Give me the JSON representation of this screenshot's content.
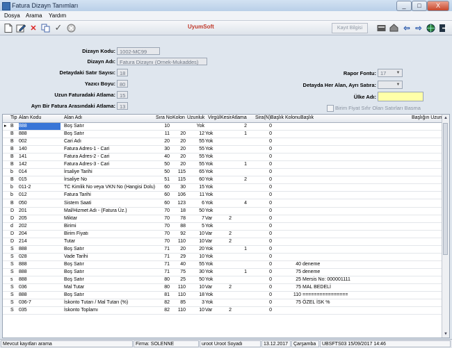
{
  "window": {
    "title": "Fatura Dizayn Tanımları",
    "min": "_",
    "max": "□",
    "close": "X"
  },
  "menu": [
    "Dosya",
    "Arama",
    "Yardım"
  ],
  "toolbar": {
    "brand": "UyumSoft",
    "kayit_label": "Kayıt Bilgisi"
  },
  "form": {
    "dizayn_kodu": {
      "label": "Dizayn Kodu:",
      "value": "1002-MC99"
    },
    "dizayn_adi": {
      "label": "Dizayn Adı:",
      "value": "Fatura Dizaynı (Ornek-Mukaddes)"
    },
    "detay_satir": {
      "label": "Detaydaki Satır Sayısı:",
      "value": "18"
    },
    "yazici_boyu": {
      "label": "Yazıcı Boyu:",
      "value": "80"
    },
    "uzun_fatura": {
      "label": "Uzun Faturadaki Atlama:",
      "value": "15"
    },
    "ayri_fatura": {
      "label": "Ayrı Bir Fatura Arasındaki Atlama:",
      "value": "13"
    },
    "rapor_fontu": {
      "label": "Rapor Fontu:",
      "value": "17"
    },
    "detay_ayri": {
      "label": "Detayda Her Alan, Ayrı Satıra:",
      "value": ""
    },
    "ulke_adi": {
      "label": "Ülke Adı:",
      "value": ""
    },
    "birim_fiyat": {
      "label": "Birim Fiyat Sıfır Olan Satırları Basma"
    }
  },
  "grid": {
    "headers": [
      "Tip",
      "Alan Kodu",
      "Alan Adı",
      "Sıra No",
      "Kolon",
      "Uzunluk",
      "Virgül",
      "Kesir",
      "Atlama",
      "Sira(N)",
      "Başlık Kolonu",
      "Başlık",
      "Başlığın Uzun"
    ],
    "rows": [
      [
        "B",
        "888",
        "Boş Satır",
        "10",
        "",
        "Yok",
        "",
        "",
        "2",
        "0",
        "",
        ""
      ],
      [
        "B",
        "888",
        "Boş Satır",
        "11",
        "20",
        "12",
        "Yok",
        "",
        "1",
        "0",
        "",
        ""
      ],
      [
        "B",
        "002",
        "Cari Adı",
        "20",
        "20",
        "55",
        "Yok",
        "",
        "",
        "0",
        "",
        ""
      ],
      [
        "B",
        "140",
        "Fatura Adres-1  -  Cari",
        "30",
        "20",
        "55",
        "Yok",
        "",
        "",
        "0",
        "",
        ""
      ],
      [
        "B",
        "141",
        "Fatura Adres-2  -  Cari",
        "40",
        "20",
        "55",
        "Yok",
        "",
        "",
        "0",
        "",
        ""
      ],
      [
        "B",
        "142",
        "Fatura Adres-3  -  Cari",
        "50",
        "20",
        "55",
        "Yok",
        "",
        "1",
        "0",
        "",
        ""
      ],
      [
        "b",
        "014",
        "İrsaliye Tarihi",
        "50",
        "115",
        "65",
        "Yok",
        "",
        "",
        "0",
        "",
        ""
      ],
      [
        "B",
        "015",
        "İrsaliye No",
        "51",
        "115",
        "60",
        "Yok",
        "",
        "2",
        "0",
        "",
        ""
      ],
      [
        "b",
        "011-2",
        "TC Kimlik No veya VKN No (Hangisi Dolu)",
        "60",
        "30",
        "15",
        "Yok",
        "",
        "",
        "0",
        "",
        ""
      ],
      [
        "b",
        "012",
        "Fatura Tarihi",
        "60",
        "106",
        "11",
        "Yok",
        "",
        "",
        "0",
        "",
        ""
      ],
      [
        "B",
        "050",
        "Sistem Saati",
        "60",
        "123",
        "6",
        "Yok",
        "",
        "4",
        "0",
        "",
        ""
      ],
      [
        "D",
        "201",
        "Mal/Hizmet Adı  - (Fatura Üz.)",
        "70",
        "18",
        "50",
        "Yok",
        "",
        "",
        "0",
        "",
        ""
      ],
      [
        "D",
        "205",
        "Miktar",
        "70",
        "78",
        "7",
        "Var",
        "2",
        "",
        "0",
        "",
        ""
      ],
      [
        "d",
        "202",
        "Birimi",
        "70",
        "88",
        "5",
        "Yok",
        "",
        "",
        "0",
        "",
        ""
      ],
      [
        "D",
        "204",
        "Birim Fiyatı",
        "70",
        "92",
        "10",
        "Var",
        "2",
        "",
        "0",
        "",
        ""
      ],
      [
        "D",
        "214",
        "Tutar",
        "70",
        "110",
        "10",
        "Var",
        "2",
        "",
        "0",
        "",
        ""
      ],
      [
        "S",
        "888",
        "Boş Satır",
        "71",
        "20",
        "20",
        "Yok",
        "",
        "1",
        "0",
        "",
        ""
      ],
      [
        "S",
        "028",
        "Vade Tarihi",
        "71",
        "29",
        "10",
        "Yok",
        "",
        "",
        "0",
        "",
        ""
      ],
      [
        "S",
        "888",
        "Boş Satır",
        "71",
        "40",
        "55",
        "Yok",
        "",
        "",
        "0",
        "40",
        "deneme"
      ],
      [
        "S",
        "888",
        "Boş Satır",
        "71",
        "75",
        "30",
        "Yok",
        "",
        "1",
        "0",
        "75",
        "deneme"
      ],
      [
        "s",
        "888",
        "Boş Satır",
        "80",
        "25",
        "50",
        "Yok",
        "",
        "",
        "0",
        "25",
        "Mersis No: 000001111"
      ],
      [
        "S",
        "036",
        "Mal Tutar",
        "80",
        "110",
        "10",
        "Var",
        "2",
        "",
        "0",
        "75",
        "MAL BEDELİ"
      ],
      [
        "S",
        "888",
        "Boş Satır",
        "81",
        "110",
        "18",
        "Yok",
        "",
        "",
        "0",
        "110",
        "================"
      ],
      [
        "S",
        "036-7",
        "İskonto Tutarı / Mal Tutarı (%)",
        "82",
        "85",
        "3",
        "Yok",
        "",
        "",
        "0",
        "75",
        "ÖZEL İSK %"
      ],
      [
        "S",
        "035",
        "İskonto Toplamı",
        "82",
        "110",
        "10",
        "Var",
        "2",
        "",
        "0",
        "",
        ""
      ]
    ]
  },
  "status": [
    "Mevcut kayıtları arama",
    "Firma: SOLENNE",
    "uroot Uroot Soyadı",
    "13.12.2017",
    "Çarşamba",
    "UBSFTS03 15/09/2017 14:46"
  ]
}
